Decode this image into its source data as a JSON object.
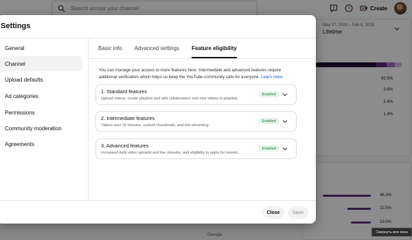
{
  "background": {
    "search_placeholder": "Search across your channel",
    "create_label": "Create",
    "date_range": "May 27, 2024 – Feb 6, 2025",
    "date_value": "Lifetime",
    "stats": [
      "92.5%",
      "3.6%",
      "2.4%",
      "1.4%"
    ],
    "bottom_stats": [
      {
        "label": "46.3%",
        "fraction": 0.463
      },
      {
        "label": "22.5%",
        "fraction": 0.225
      },
      {
        "label": "19.0%",
        "fraction": 0.19
      }
    ],
    "georgia_label": "Georgia",
    "bar_colors": [
      "#1f1130",
      "#5e2a7e",
      "#a86fc9",
      "#d8b6ec"
    ],
    "bar_fractions": [
      0.7,
      0.12,
      0.1,
      0.08
    ]
  },
  "dialog": {
    "title": "Settings",
    "sidebar": {
      "items": [
        {
          "label": "General"
        },
        {
          "label": "Channel"
        },
        {
          "label": "Upload defaults"
        },
        {
          "label": "Ad categories"
        },
        {
          "label": "Permissions"
        },
        {
          "label": "Community moderation"
        },
        {
          "label": "Agreements"
        }
      ],
      "active": "Channel"
    },
    "tabs": [
      {
        "label": "Basic info"
      },
      {
        "label": "Advanced settings"
      },
      {
        "label": "Feature eligibility"
      }
    ],
    "active_tab": "Feature eligibility",
    "intro_text": "You can manage your access to more features here. Intermediate and advanced features require additional verification which helps us keep the YouTube community safe for everyone.",
    "intro_link": "Learn more",
    "features": [
      {
        "title": "1. Standard features",
        "description": "Upload videos, create playlists and add collaborators and new videos to playlists",
        "status": "Enabled"
      },
      {
        "title": "2. Intermediate features",
        "description": "Videos over 15 minutes, custom thumbnails, and live streaming",
        "status": "Enabled"
      },
      {
        "title": "3. Advanced features",
        "description": "Increased daily video uploads and live streams, and eligibility to apply for moneti...",
        "status": "Enabled"
      }
    ],
    "buttons": {
      "close": "Close",
      "save": "Save"
    }
  },
  "tooltip": "Свернуть все окна",
  "colors": {
    "accent_link": "#065fd4",
    "enabled_bg": "#e6f4ea",
    "enabled_text": "#1e7e34",
    "overlay": "rgba(0,0,0,0.45)"
  }
}
